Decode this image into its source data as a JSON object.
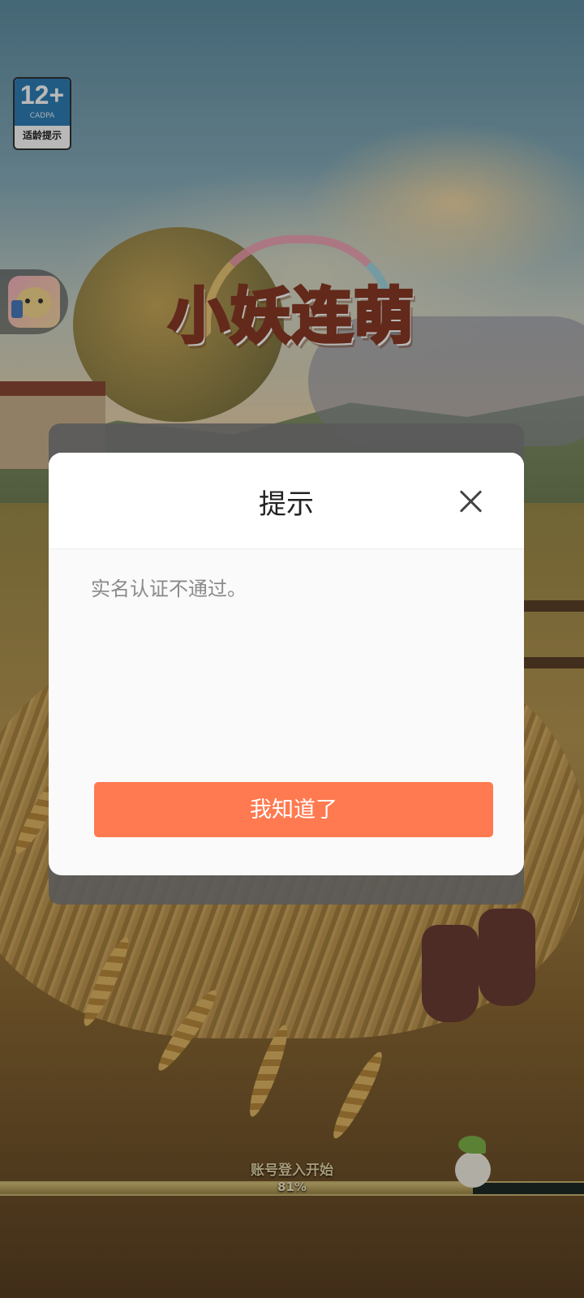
{
  "game": {
    "logo_text": "小妖连萌"
  },
  "age_rating": {
    "number": "12+",
    "org": "CADPA",
    "tip": "适龄提示"
  },
  "dialog": {
    "title": "提示",
    "message": "实名认证不通过。",
    "confirm_label": "我知道了"
  },
  "loading": {
    "label": "账号登入开始",
    "percent_text": "81%",
    "progress": 0.81
  },
  "colors": {
    "confirm_button": "#ff7a50",
    "age_badge": "#2f7fb6"
  }
}
